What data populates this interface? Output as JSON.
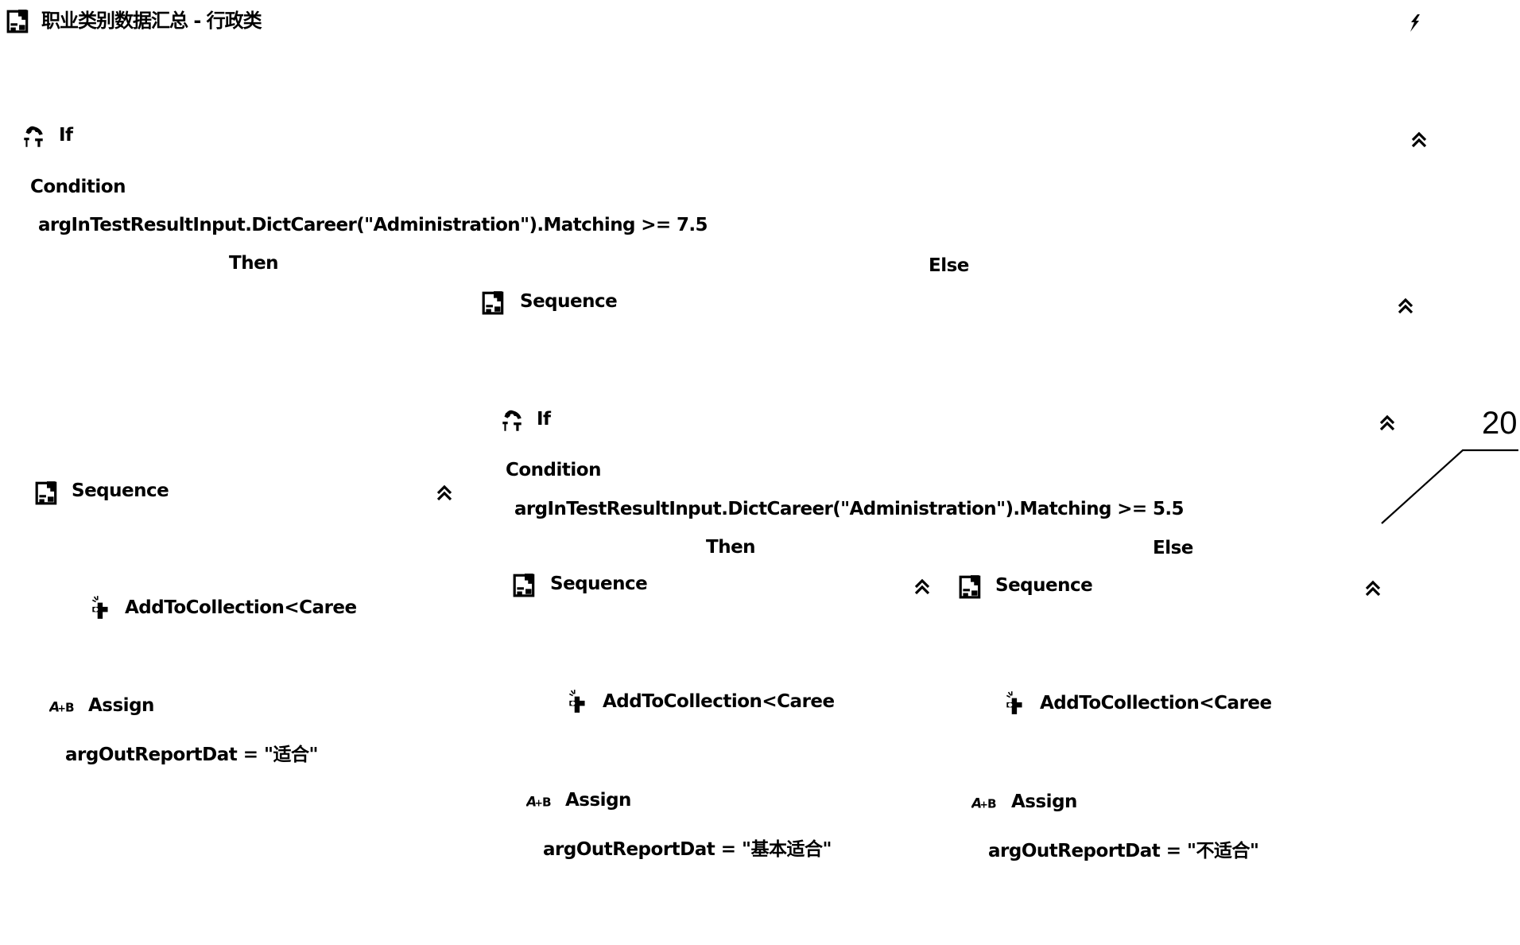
{
  "window": {
    "title": "职业类别数据汇总 - 行政类",
    "title_icon": "sequence-icon",
    "corner_icon": "lightning-icon"
  },
  "outer_if": {
    "label": "If",
    "icon": "if-branch-icon",
    "condition_label": "Condition",
    "condition": "argInTestResultInput.DictCareer(\"Administration\").Matching >= 7.5",
    "then_label": "Then",
    "else_label": "Else",
    "collapse_icon": "double-chevron-up-icon"
  },
  "then_sequence": {
    "label": "Sequence",
    "icon": "sequence-icon",
    "activities": [
      {
        "type": "add",
        "label": "AddToCollection<Caree",
        "icon": "add-to-collection-icon"
      },
      {
        "type": "assign",
        "label": "Assign",
        "icon": "assign-icon",
        "value": "argOutReportDat  =  \"适合\""
      }
    ]
  },
  "else_sequence": {
    "label": "Sequence",
    "icon": "sequence-icon",
    "inner_if": {
      "label": "If",
      "icon": "if-branch-icon",
      "condition_label": "Condition",
      "condition": "argInTestResultInput.DictCareer(\"Administration\").Matching >= 5.5",
      "then_label": "Then",
      "else_label": "Else",
      "then_sequence": {
        "label": "Sequence",
        "activities": [
          {
            "type": "add",
            "label": "AddToCollection<Caree"
          },
          {
            "type": "assign",
            "label": "Assign",
            "value": "argOutReportDat  =  \"基本适合\""
          }
        ]
      },
      "else_sequence": {
        "label": "Sequence",
        "activities": [
          {
            "type": "add",
            "label": "AddToCollection<Caree"
          },
          {
            "type": "assign",
            "label": "Assign",
            "value": "argOutReportDat  =  \"不适合\""
          }
        ]
      }
    }
  },
  "annotation": {
    "reference_number": "20"
  }
}
